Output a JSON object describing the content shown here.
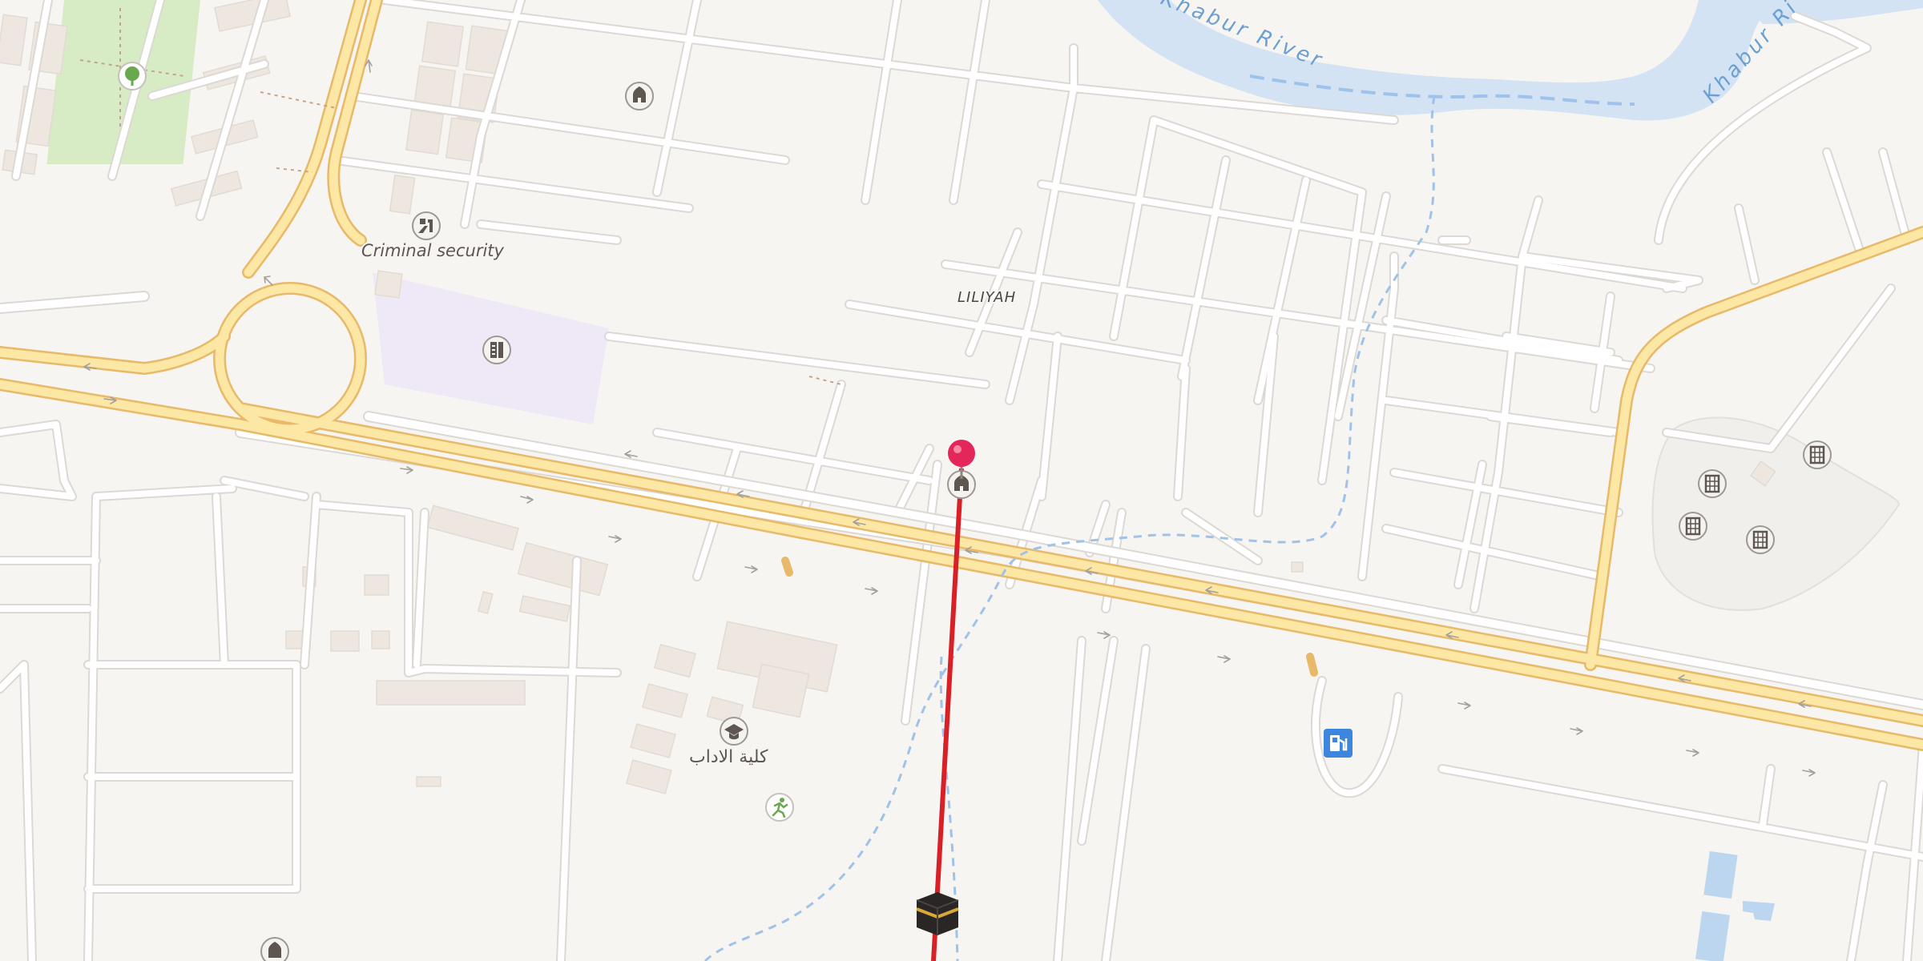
{
  "map": {
    "labels": {
      "river_west": "Khabur River",
      "river_east": "Khabur Ri",
      "criminal_security": "Criminal security",
      "district": "LILIYAH",
      "college": "كلية الاداب"
    },
    "colors": {
      "land": "#f7f5f2",
      "street": "#ffffff",
      "street_casing": "#dcd8d4",
      "major_road_fill": "#fde7a4",
      "major_road_casing": "#e7b969",
      "water": "#d3e3f4",
      "park": "#d7ebc4",
      "institution": "#efe8f6",
      "building": "#ede7e0",
      "route_line": "#d82027",
      "pin": "#e5265a",
      "fuel": "#3d86e0",
      "path": "#9fc2ea"
    },
    "pois": [
      {
        "name": "park-tree-icon",
        "kind": "tree"
      },
      {
        "name": "mosque-icon-north",
        "kind": "mosque"
      },
      {
        "name": "police-icon",
        "kind": "police"
      },
      {
        "name": "ministry-icon",
        "kind": "office"
      },
      {
        "name": "mosque-icon-pin",
        "kind": "mosque"
      },
      {
        "name": "school-icon",
        "kind": "graduation-cap"
      },
      {
        "name": "sport-icon",
        "kind": "runner"
      },
      {
        "name": "fuel-icon",
        "kind": "fuel-pump"
      },
      {
        "name": "cemetery-icon-1",
        "kind": "tomb"
      },
      {
        "name": "cemetery-icon-2",
        "kind": "tomb"
      },
      {
        "name": "cemetery-icon-3",
        "kind": "tomb"
      },
      {
        "name": "cemetery-icon-4",
        "kind": "tomb"
      },
      {
        "name": "mosque-icon-south",
        "kind": "mosque"
      }
    ],
    "markers": {
      "pin": "red-pin-icon",
      "qibla": "kaaba-icon"
    }
  }
}
